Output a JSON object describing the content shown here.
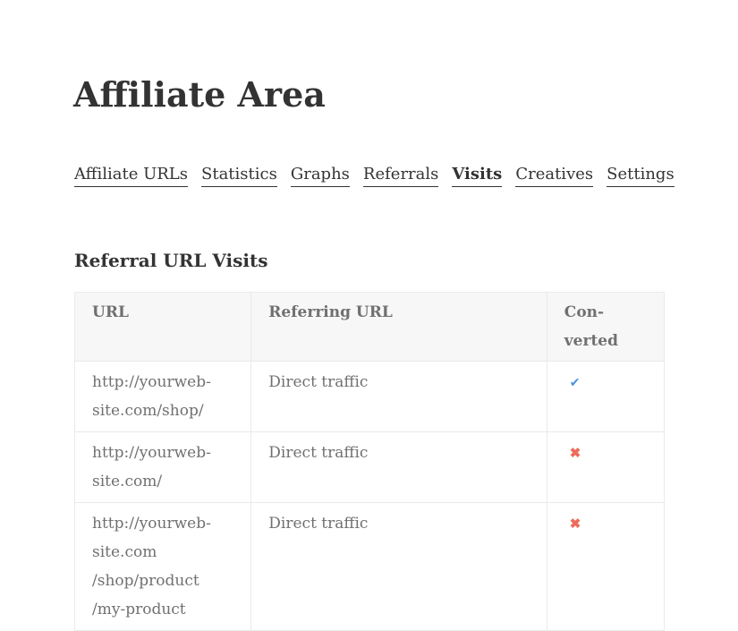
{
  "page": {
    "title": "Affiliate Area"
  },
  "tabs": [
    {
      "label": "Affiliate URLs",
      "active": false
    },
    {
      "label": "Statistics",
      "active": false
    },
    {
      "label": "Graphs",
      "active": false
    },
    {
      "label": "Referrals",
      "active": false
    },
    {
      "label": "Visits",
      "active": true
    },
    {
      "label": "Creatives",
      "active": false
    },
    {
      "label": "Settings",
      "active": false
    }
  ],
  "section": {
    "title": "Referral URL Visits"
  },
  "table": {
    "headers": {
      "url": "URL",
      "referring_url": "Referring URL",
      "converted_line1": "Con-",
      "converted_line2": "verted"
    },
    "rows": [
      {
        "url_lines": [
          "http://yourweb-",
          "site.com/shop/"
        ],
        "referring_url": "Direct traffic",
        "converted": true,
        "converted_icon": "checkmark-icon",
        "converted_glyph": "✔"
      },
      {
        "url_lines": [
          "http://yourweb-",
          "site.com/"
        ],
        "referring_url": "Direct traffic",
        "converted": false,
        "converted_icon": "cross-icon",
        "converted_glyph": "✖"
      },
      {
        "url_lines": [
          "http://yourweb-",
          "site.com",
          "/shop/product",
          "/my-product"
        ],
        "referring_url": "Direct traffic",
        "converted": false,
        "converted_icon": "cross-icon",
        "converted_glyph": "✖"
      }
    ]
  },
  "colors": {
    "check": "#4a90e2",
    "cross": "#ee6b5b",
    "text": "#333333",
    "table_text": "#707070",
    "header_bg": "#f7f7f7",
    "border": "#eaeaea"
  }
}
